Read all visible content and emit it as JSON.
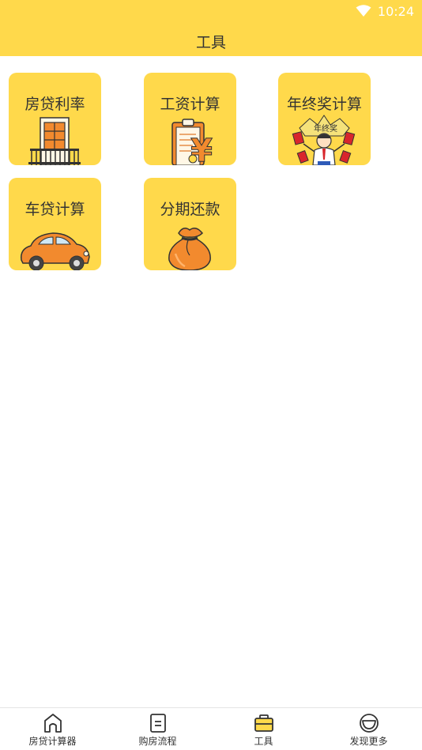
{
  "status_bar": {
    "time": "10:24",
    "wifi_icon": "wifi-icon"
  },
  "header": {
    "title": "工具"
  },
  "tools": [
    {
      "label": "房贷利率",
      "icon": "building-door-icon"
    },
    {
      "label": "工资计算",
      "icon": "clipboard-yuan-icon"
    },
    {
      "label": "年终奖计算",
      "icon": "celebrating-man-icon"
    },
    {
      "label": "车贷计算",
      "icon": "car-icon"
    },
    {
      "label": "分期还款",
      "icon": "money-bag-icon"
    }
  ],
  "bottom_nav": {
    "active": "工具",
    "items": [
      {
        "label": "房贷计算器",
        "icon": "home-icon"
      },
      {
        "label": "购房流程",
        "icon": "document-icon"
      },
      {
        "label": "工具",
        "icon": "briefcase-icon"
      },
      {
        "label": "发现更多",
        "icon": "discover-icon"
      }
    ]
  },
  "colors": {
    "accent": "#ffd94b",
    "text": "#333333",
    "orange": "#f28a2e",
    "background": "#ffffff"
  }
}
